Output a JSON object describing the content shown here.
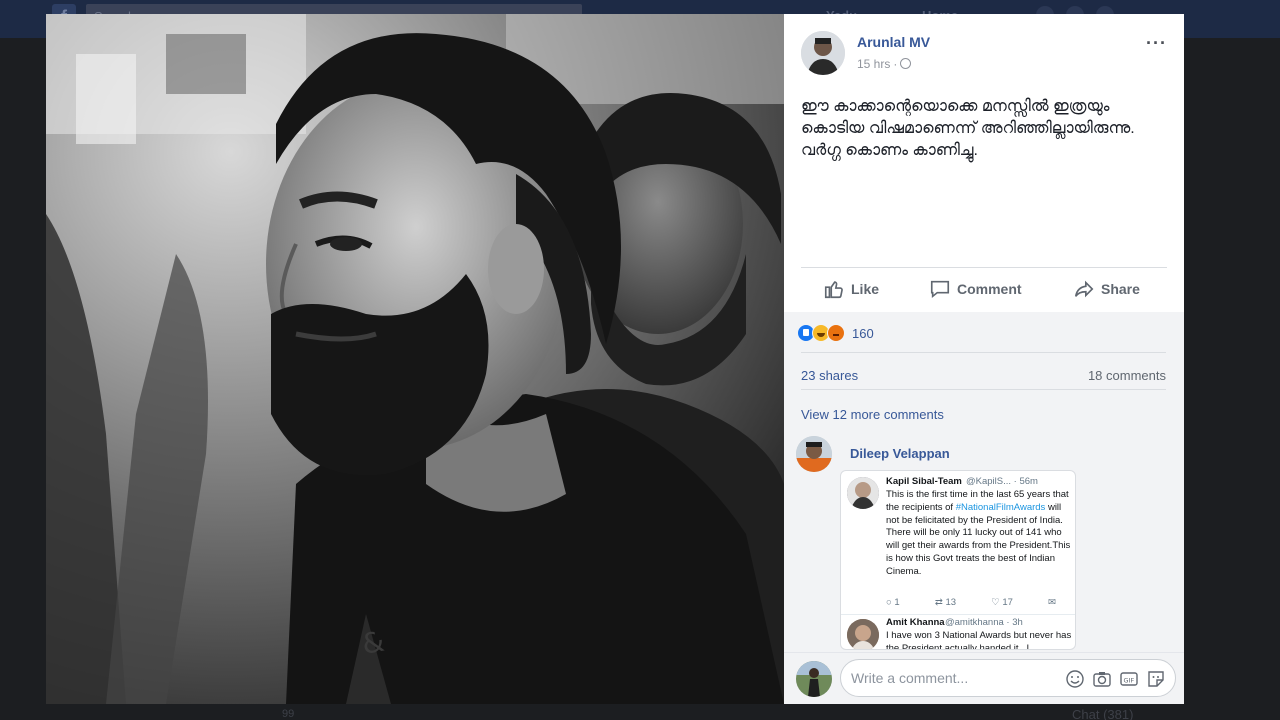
{
  "topbar": {
    "logo": "f",
    "search_placeholder": "Search",
    "nav": [
      "Yadu",
      "Home"
    ]
  },
  "post": {
    "author": "Arunlal MV",
    "time": "15 hrs",
    "sep": "·",
    "more": "···",
    "text": "ഈ കാക്കാന്റെയൊക്കെ മനസ്സിൽ ഇത്രയും കൊടിയ വിഷമാണെന്ന് അറിഞ്ഞില്ലായിരുന്നു. വർഗ്ഗ കൊണം കാണിച്ചു.",
    "actions": {
      "like": "Like",
      "comment": "Comment",
      "share": "Share"
    }
  },
  "engagement": {
    "reaction_count": "160",
    "shares": "23 shares",
    "comments": "18 comments",
    "view_more": "View 12 more comments"
  },
  "comment": {
    "author": "Dileep Velappan",
    "tweet1": {
      "name": "Kapil Sibal-Team",
      "handle": "@KapilS... · 56m",
      "body_before": "This is the first time in the last 65 years that the recipients of ",
      "hashtag": "#NationalFilmAwards",
      "body_after": " will not be felicitated by the President of India. There will be only 11 lucky out of 141 who will get their awards from the President.This is how this Govt treats the best of Indian Cinema.",
      "replies": "1",
      "retweets": "13",
      "likes": "17"
    },
    "tweet2": {
      "name": "Amit Khanna",
      "handle": "@amitkhanna · 3h",
      "body": "I have won 3 National Awards but never has the President actually handed it . I"
    }
  },
  "composer": {
    "placeholder": "Write a comment..."
  },
  "background": {
    "reaction_count": "99",
    "chat": "Chat (381)"
  },
  "colors": {
    "link": "#385898",
    "like_blue": "#1877f2",
    "panel_bg": "#ffffff",
    "comments_bg": "#f2f3f5"
  }
}
